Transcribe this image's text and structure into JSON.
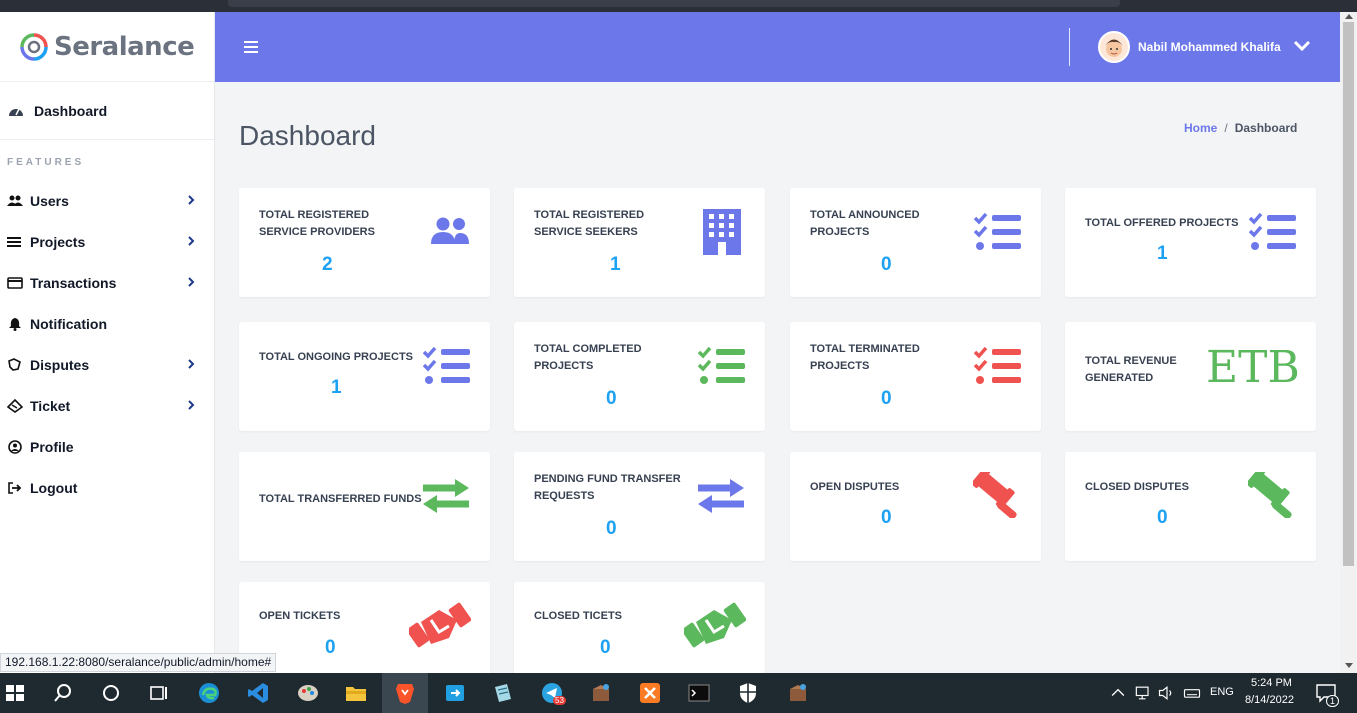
{
  "app": {
    "logo_text": "Seralance"
  },
  "browser": {
    "status_url": "192.168.1.22:8080/seralance/public/admin/home#"
  },
  "sidebar": {
    "dashboard_label": "Dashboard",
    "features_label": "FEATURES",
    "items": [
      {
        "label": "Users",
        "icon": "users-icon",
        "has_submenu": true
      },
      {
        "label": "Projects",
        "icon": "list-icon",
        "has_submenu": true
      },
      {
        "label": "Transactions",
        "icon": "credit-card-icon",
        "has_submenu": true
      },
      {
        "label": "Notification",
        "icon": "bell-icon",
        "has_submenu": false
      },
      {
        "label": "Disputes",
        "icon": "gavel-icon",
        "has_submenu": true
      },
      {
        "label": "Ticket",
        "icon": "ticket-icon",
        "has_submenu": true
      },
      {
        "label": "Profile",
        "icon": "user-circle-icon",
        "has_submenu": false
      },
      {
        "label": "Logout",
        "icon": "logout-icon",
        "has_submenu": false
      }
    ]
  },
  "header": {
    "username": "Nabil Mohammed Khalifa"
  },
  "page": {
    "title": "Dashboard",
    "breadcrumb": {
      "home": "Home",
      "separator": "/",
      "current": "Dashboard"
    }
  },
  "cards": [
    {
      "label": "TOTAL REGISTERED SERVICE PROVIDERS",
      "value": "2",
      "icon": "users-icon",
      "color": "#6c78ea"
    },
    {
      "label": "TOTAL REGISTERED SERVICE SEEKERS",
      "value": "1",
      "icon": "building-icon",
      "color": "#6c78ea"
    },
    {
      "label": "TOTAL ANNOUNCED PROJECTS",
      "value": "0",
      "icon": "tasks-icon",
      "color": "#6c78ea"
    },
    {
      "label": "TOTAL OFFERED PROJECTS",
      "value": "1",
      "icon": "tasks-icon",
      "color": "#6c78ea"
    },
    {
      "label": "TOTAL ONGOING PROJECTS",
      "value": "1",
      "icon": "tasks-icon",
      "color": "#6c78ea"
    },
    {
      "label": "TOTAL COMPLETED PROJECTS",
      "value": "0",
      "icon": "tasks-icon",
      "color": "#5cb85c"
    },
    {
      "label": "TOTAL TERMINATED PROJECTS",
      "value": "0",
      "icon": "tasks-icon",
      "color": "#f0524f"
    },
    {
      "label": "TOTAL REVENUE GENERATED",
      "value": "ETB",
      "icon": "currency-text",
      "color": "#5cb85c"
    },
    {
      "label": "TOTAL TRANSFERRED FUNDS",
      "value": "",
      "icon": "exchange-icon",
      "color": "#5cb85c"
    },
    {
      "label": "PENDING FUND TRANSFER REQUESTS",
      "value": "0",
      "icon": "exchange-icon",
      "color": "#6c78ea"
    },
    {
      "label": "OPEN DISPUTES",
      "value": "0",
      "icon": "gavel-icon",
      "color": "#f0524f"
    },
    {
      "label": "CLOSED DISPUTES",
      "value": "0",
      "icon": "gavel-icon",
      "color": "#5cb85c"
    },
    {
      "label": "OPEN TICKETS",
      "value": "0",
      "icon": "handshake-icon",
      "color": "#f0524f"
    },
    {
      "label": "CLOSED TICETS",
      "value": "0",
      "icon": "handshake-icon",
      "color": "#5cb85c"
    }
  ],
  "taskbar": {
    "language": "ENG",
    "time": "5:24 PM",
    "date": "8/14/2022",
    "telegram_badge": "53",
    "notification_badge": "1"
  }
}
